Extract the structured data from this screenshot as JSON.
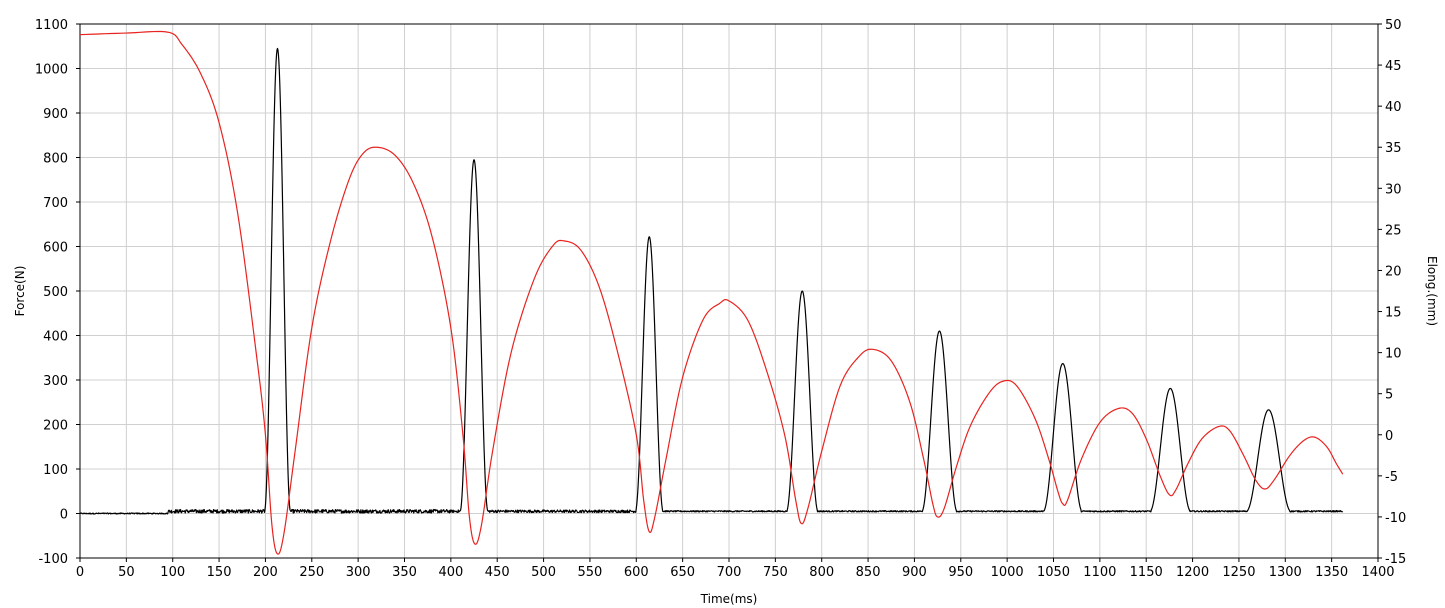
{
  "chart_data": {
    "type": "line",
    "title": "",
    "xlabel": "Time(ms)",
    "ylabel": "Force(N)",
    "y2label": "Elong.(mm)",
    "xlim": [
      0,
      1400
    ],
    "ylim": [
      -100,
      1100
    ],
    "y2lim": [
      -15,
      50
    ],
    "x_ticks": [
      0,
      50,
      100,
      150,
      200,
      250,
      300,
      350,
      400,
      450,
      500,
      550,
      600,
      650,
      700,
      750,
      800,
      850,
      900,
      950,
      1000,
      1050,
      1100,
      1150,
      1200,
      1250,
      1300,
      1350,
      1400
    ],
    "y_ticks": [
      -100,
      0,
      100,
      200,
      300,
      400,
      500,
      600,
      700,
      800,
      900,
      1000,
      1100
    ],
    "y2_ticks": [
      -15,
      -10,
      -5,
      0,
      5,
      10,
      15,
      20,
      25,
      30,
      35,
      40,
      45,
      50
    ],
    "grid": true,
    "series": [
      {
        "color": "#000000",
        "axis": "left",
        "baseline": 5,
        "x_end": 1362,
        "peaks": [
          {
            "center": 213,
            "peak": 1045,
            "half_width": 14
          },
          {
            "center": 425,
            "peak": 795,
            "half_width": 15
          },
          {
            "center": 614,
            "peak": 622,
            "half_width": 15
          },
          {
            "center": 779,
            "peak": 500,
            "half_width": 17
          },
          {
            "center": 927,
            "peak": 410,
            "half_width": 19
          },
          {
            "center": 1060,
            "peak": 337,
            "half_width": 21
          },
          {
            "center": 1176,
            "peak": 281,
            "half_width": 22
          },
          {
            "center": 1282,
            "peak": 233,
            "half_width": 24
          }
        ]
      },
      {
        "color": "#e8231f",
        "axis": "right",
        "x_end": 1362,
        "points": [
          [
            0,
            48.7
          ],
          [
            50,
            48.9
          ],
          [
            95,
            49
          ],
          [
            110,
            47.5
          ],
          [
            130,
            44
          ],
          [
            150,
            38
          ],
          [
            170,
            27
          ],
          [
            190,
            10
          ],
          [
            200,
            0
          ],
          [
            207,
            -11
          ],
          [
            213,
            -14.5
          ],
          [
            220,
            -12
          ],
          [
            232,
            -2
          ],
          [
            250,
            13
          ],
          [
            270,
            23.5
          ],
          [
            290,
            31
          ],
          [
            305,
            34.2
          ],
          [
            320,
            35
          ],
          [
            340,
            34
          ],
          [
            360,
            30.5
          ],
          [
            380,
            24
          ],
          [
            400,
            13
          ],
          [
            413,
            0
          ],
          [
            420,
            -10
          ],
          [
            426,
            -13.3
          ],
          [
            433,
            -11
          ],
          [
            445,
            -2
          ],
          [
            465,
            10
          ],
          [
            490,
            19
          ],
          [
            510,
            23
          ],
          [
            522,
            23.6
          ],
          [
            540,
            22.5
          ],
          [
            560,
            18
          ],
          [
            580,
            10
          ],
          [
            600,
            0
          ],
          [
            608,
            -8
          ],
          [
            614,
            -11.8
          ],
          [
            620,
            -10
          ],
          [
            632,
            -3
          ],
          [
            650,
            7
          ],
          [
            672,
            14
          ],
          [
            690,
            16
          ],
          [
            700,
            16.3
          ],
          [
            720,
            14
          ],
          [
            740,
            8
          ],
          [
            760,
            0
          ],
          [
            772,
            -8
          ],
          [
            778,
            -10.8
          ],
          [
            785,
            -9
          ],
          [
            800,
            -2
          ],
          [
            820,
            6
          ],
          [
            840,
            9.5
          ],
          [
            855,
            10.4
          ],
          [
            875,
            9
          ],
          [
            895,
            4
          ],
          [
            910,
            -3
          ],
          [
            920,
            -8.5
          ],
          [
            925,
            -10
          ],
          [
            932,
            -9
          ],
          [
            945,
            -4
          ],
          [
            960,
            1
          ],
          [
            980,
            5
          ],
          [
            995,
            6.5
          ],
          [
            1010,
            6
          ],
          [
            1030,
            2
          ],
          [
            1045,
            -3
          ],
          [
            1055,
            -7
          ],
          [
            1060,
            -8.4
          ],
          [
            1065,
            -8
          ],
          [
            1080,
            -3
          ],
          [
            1100,
            1.5
          ],
          [
            1120,
            3.2
          ],
          [
            1135,
            2.6
          ],
          [
            1150,
            -0.5
          ],
          [
            1165,
            -5
          ],
          [
            1175,
            -7.3
          ],
          [
            1182,
            -6.7
          ],
          [
            1195,
            -3.5
          ],
          [
            1210,
            -0.5
          ],
          [
            1228,
            1
          ],
          [
            1240,
            0.5
          ],
          [
            1255,
            -2.5
          ],
          [
            1268,
            -5.5
          ],
          [
            1278,
            -6.6
          ],
          [
            1288,
            -5.5
          ],
          [
            1305,
            -2.5
          ],
          [
            1320,
            -0.7
          ],
          [
            1332,
            -0.3
          ],
          [
            1345,
            -1.5
          ],
          [
            1355,
            -3.5
          ],
          [
            1362,
            -4.8
          ]
        ]
      }
    ]
  }
}
